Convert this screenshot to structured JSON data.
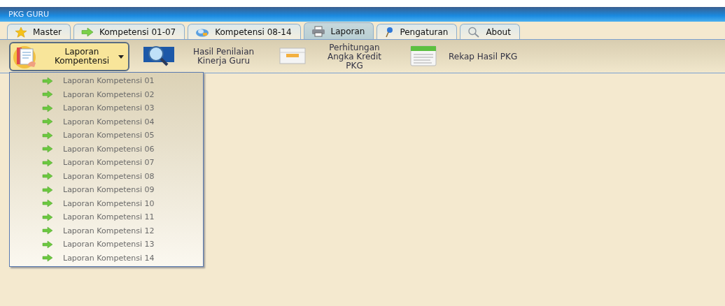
{
  "window": {
    "title": "PKG GURU"
  },
  "tabs": [
    {
      "label": "Master",
      "selected": false
    },
    {
      "label": "Kompetensi 01-07",
      "selected": false
    },
    {
      "label": "Kompetensi 08-14",
      "selected": false
    },
    {
      "label": "Laporan",
      "selected": true
    },
    {
      "label": "Pengaturan",
      "selected": false
    },
    {
      "label": "About",
      "selected": false
    }
  ],
  "ribbon": [
    {
      "label": "Laporan Kompentensi",
      "kind": "dropdown",
      "expanded": true
    },
    {
      "label": "Hasil Penilaian Kinerja Guru",
      "kind": "button"
    },
    {
      "label": "Perhitungan Angka Kredit PKG",
      "kind": "button"
    },
    {
      "label": "Rekap Hasil PKG",
      "kind": "button"
    }
  ],
  "menu": {
    "items": [
      "Laporan Kompetensi 01",
      "Laporan Kompetensi 02",
      "Laporan Kompetensi 03",
      "Laporan Kompetensi 04",
      "Laporan Kompetensi 05",
      "Laporan Kompetensi 06",
      "Laporan Kompetensi 07",
      "Laporan Kompetensi 08",
      "Laporan Kompetensi 09",
      "Laporan Kompetensi 10",
      "Laporan Kompetensi 11",
      "Laporan Kompetensi 12",
      "Laporan Kompetensi 13",
      "Laporan Kompetensi 14"
    ]
  }
}
